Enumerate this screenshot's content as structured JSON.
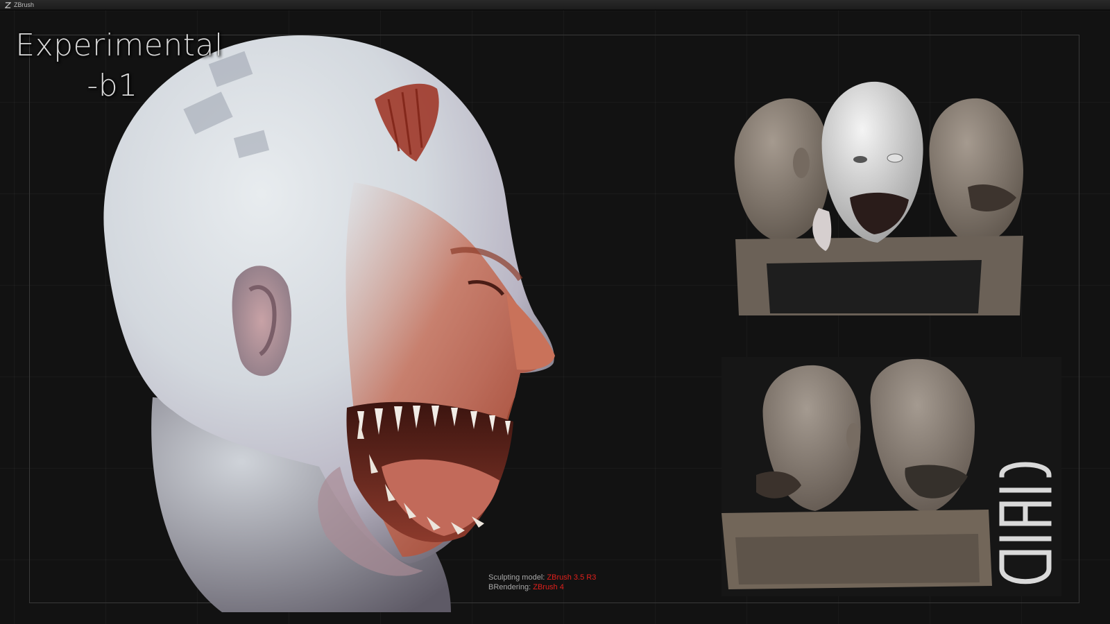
{
  "window": {
    "title": "ZBrush",
    "logo_icon": "zbrush-logo-icon"
  },
  "canvas": {
    "title_line1": "Experimental",
    "title_line2": "-b1",
    "credits": {
      "sculpt_label": "Sculpting model:",
      "sculpt_value": "ZBrush 3.5 R3",
      "render_label": "BRendering:",
      "render_value": "ZBrush 4"
    },
    "logo_text": "CIEID"
  },
  "colors": {
    "credit_value": "#e0201c",
    "background": "#121212",
    "skin_light": "#d7dde2",
    "skin_red": "#b54a32",
    "clay": "#8a7d70"
  }
}
